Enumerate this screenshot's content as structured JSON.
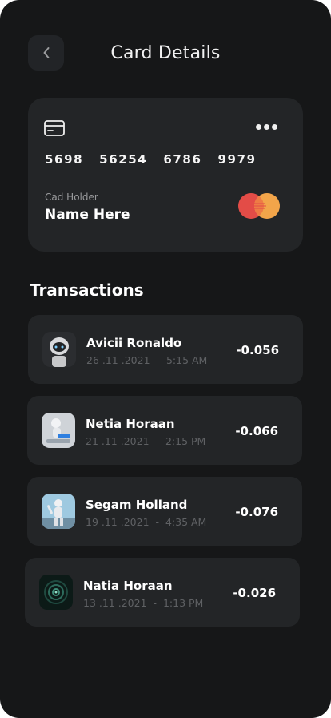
{
  "header": {
    "back_icon": "chevron-left-icon",
    "title": "Card Details"
  },
  "card": {
    "icon": "credit-card-icon",
    "more_icon": "more-horizontal-icon",
    "number_groups": [
      "5698",
      "56254",
      "6786",
      "9979"
    ],
    "holder_label": "Cad Holder",
    "holder_name": "Name Here",
    "brand_logo": "mastercard-logo",
    "colors": {
      "brand_left": "#e34c47",
      "brand_right": "#f2a54a"
    }
  },
  "transactions": {
    "title": "Transactions",
    "items": [
      {
        "name": "Avicii Ronaldo",
        "date": "26 .11 .2021",
        "separator": "-",
        "time": "5:15 AM",
        "amount": "-0.056",
        "avatar": "robot-avatar"
      },
      {
        "name": "Netia Horaan",
        "date": "21 .11 .2021",
        "separator": "-",
        "time": "2:15 PM",
        "amount": "-0.066",
        "avatar": "robot-avatar"
      },
      {
        "name": "Segam Holland",
        "date": "19 .11 .2021",
        "separator": "-",
        "time": "4:35 AM",
        "amount": "-0.076",
        "avatar": "robot-avatar"
      },
      {
        "name": "Natia Horaan",
        "date": "13 .11 .2021",
        "separator": "-",
        "time": "1:13 PM",
        "amount": "-0.026",
        "avatar": "abstract-avatar"
      }
    ]
  },
  "colors": {
    "background": "#161718",
    "surface": "#232527",
    "muted_text": "#5f6164"
  }
}
